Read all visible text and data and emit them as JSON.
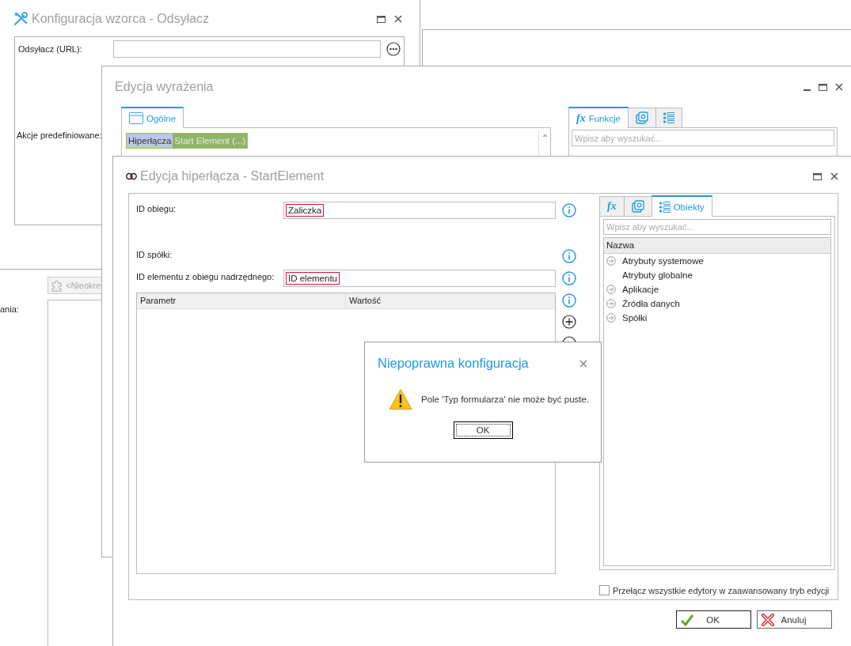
{
  "pattern_window": {
    "title": "Konfiguracja wzorca - Odsyłacz",
    "url_label": "Odsyłacz (URL):",
    "actions_label": "Akcje predefiniowane:"
  },
  "lower_window": {
    "button_label": "<Nieokre",
    "field_label": "ania:"
  },
  "expression_window": {
    "title": "Edycja wyrażenia",
    "left_tabs": [
      {
        "label": "Ogólne",
        "selected": true
      }
    ],
    "tokens": [
      {
        "kind": "category",
        "text": "Hiperłącza"
      },
      {
        "kind": "element",
        "text": "Start Element (...)"
      }
    ],
    "right_tabs": [
      {
        "kind": "functions",
        "icon_text": "fx",
        "label": "Funkcje",
        "selected": true
      },
      {
        "kind": "variables",
        "selected": false
      },
      {
        "kind": "objects",
        "selected": false
      }
    ],
    "search_placeholder": "Wpisz aby wyszukać..."
  },
  "hyperlink_window": {
    "title": "Edycja hiperłącza - StartElement",
    "fields": [
      {
        "kind": "input",
        "label": "ID obiegu:",
        "value": "Zaliczka"
      },
      {
        "kind": "label",
        "label": "ID spółki:"
      },
      {
        "kind": "input",
        "label": "ID elementu z obiegu nadrzędnego:",
        "value": "ID elementu"
      }
    ],
    "grid": {
      "columns": [
        "Parametr",
        "Wartość"
      ]
    },
    "right_tabs": [
      {
        "kind": "functions",
        "icon_text": "fx",
        "selected": false
      },
      {
        "kind": "variables",
        "selected": false
      },
      {
        "kind": "objects",
        "label": "Obiekty",
        "selected": true
      }
    ],
    "search_placeholder": "Wpisz aby wyszukać...",
    "tree": {
      "column": "Nazwa",
      "items": [
        {
          "label": "Atrybuty systemowe",
          "expandable": true
        },
        {
          "label": "Atrybuty globalne",
          "expandable": false
        },
        {
          "label": "Aplikacje",
          "expandable": true
        },
        {
          "label": "Źródła danych",
          "expandable": true
        },
        {
          "label": "Spółki",
          "expandable": true
        }
      ]
    },
    "advanced_mode": {
      "label": "Przełącz wszystkie edytory w zaawansowany tryb edycji",
      "checked": false
    },
    "buttons": [
      {
        "kind": "ok",
        "label": "OK"
      },
      {
        "kind": "cancel",
        "label": "Anuluj"
      }
    ]
  },
  "error_dialog": {
    "title": "Niepoprawna konfiguracja",
    "message": "Pole 'Typ formularza' nie może być puste.",
    "button": "OK"
  }
}
